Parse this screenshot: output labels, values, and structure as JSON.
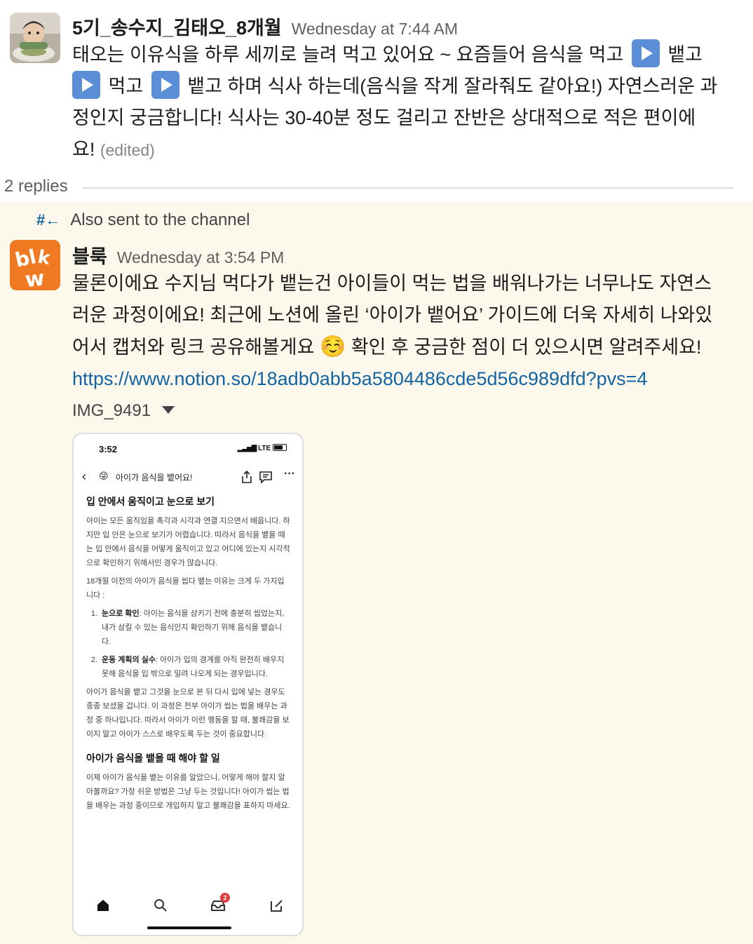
{
  "message1": {
    "author": "5기_송수지_김태오_8개월",
    "timestamp": "Wednesday at 7:44 AM",
    "line1a": "태오는 이유식을 하루 세끼로 늘려 먹고 있어요 ~ 요즘들어 음식을 먹고",
    "line1b": "뱉고",
    "line2a": "먹고",
    "line2b": "뱉고 하며 식사 하는데(음식을 작게 잘라줘도 같아요!) 자연스러운 과",
    "line3": "정인지 궁금합니다! 식사는 30-40분 정도 걸리고 잔반은 상대적으로 적은 편이에",
    "line4": "요!",
    "edited": "(edited)"
  },
  "thread": {
    "replies_label": "2 replies"
  },
  "reply": {
    "also_sent_icon": "#←",
    "also_sent": "Also sent to the channel",
    "author": "블룩",
    "timestamp": "Wednesday at 3:54 PM",
    "line1": "물론이에요 수지님 먹다가 뱉는건 아이들이 먹는 법을 배워나가는 너무나도 자연스",
    "line2": "러운 과정이에요! 최근에 노션에 올린 ‘아이가 뱉어요’ 가이드에 더욱 자세히 나와있",
    "line3a": "어서 캡처와 링크 공유해볼게요",
    "emoji": "☺️",
    "line3b": "확인 후 궁금한 점이 더 있으시면 알려주세요!",
    "link": "https://www.notion.so/18adb0abb5a5804486cde5d56c989dfd?pvs=4",
    "file_name": "IMG_9491",
    "avatar_text": "blkw"
  },
  "phone": {
    "time": "3:52",
    "network": "LTE",
    "page_emoji": "😝",
    "page_title": "아이가 음식을 뱉어요!",
    "heading1": "입 안에서 움직이고 눈으로 보기",
    "para1": "아이는 모든 움직임을 촉각과 시각과 연결 지으면서 배웁니다. 하지만 입 안은 눈으로 보기가 어렵습니다. 따라서 음식을 뱉을 때는 입 안에서 음식을 어떻게 움직이고 있고 어디에 있는지 시각적으로 확인하기 위해서인 경우가 많습니다.",
    "para2": "18개월 이전의 아이가 음식을 씹다 뱉는 이유는 크게 두 가지입니다 :",
    "item1_num": "1.",
    "item1_bold": "눈으로 확인",
    "item1_text": ": 아이는 음식을 삼키기 전에 충분히 씹었는지, 내가 삼킬 수 있는 음식인지 확인하기 위해 음식을 뱉습니다.",
    "item2_num": "2.",
    "item2_bold": "운동 계획의 실수",
    "item2_text": ": 아이가 입의 경계를 아직 완전히 배우지 못해 음식을 입 밖으로 밀려 나오게 되는 경우입니다.",
    "para3": "아이가 음식을 뱉고 그것을 눈으로 본 뒤 다시 입에 넣는 경우도 종종 보셨을 겁니다. 이 과정은 전부 아이가 씹는 법을 배우는 과정 중 하나입니다. 따라서 아이가 이런 행동을 할 때, 불쾌감을 보이지 말고 아이가 스스로 배우도록 두는 것이 중요합니다.",
    "heading2": "아이가 음식을 뱉을 때 해야 할 일",
    "para4": "이제 아이가 음식을 뱉는 이유를 알았으니, 어떻게 해야 할지 알아볼까요? 가장 쉬운 방법은 그냥 두는 것입니다! 아이가 씹는 법을 배우는 과정 중이므로 개입하지 말고 불쾌감을 표하지 마세요.",
    "inbox_badge": "2"
  },
  "colors": {
    "link": "#1264a3",
    "reply_bg": "#fcf8ec",
    "brand_orange": "#f07a22"
  }
}
